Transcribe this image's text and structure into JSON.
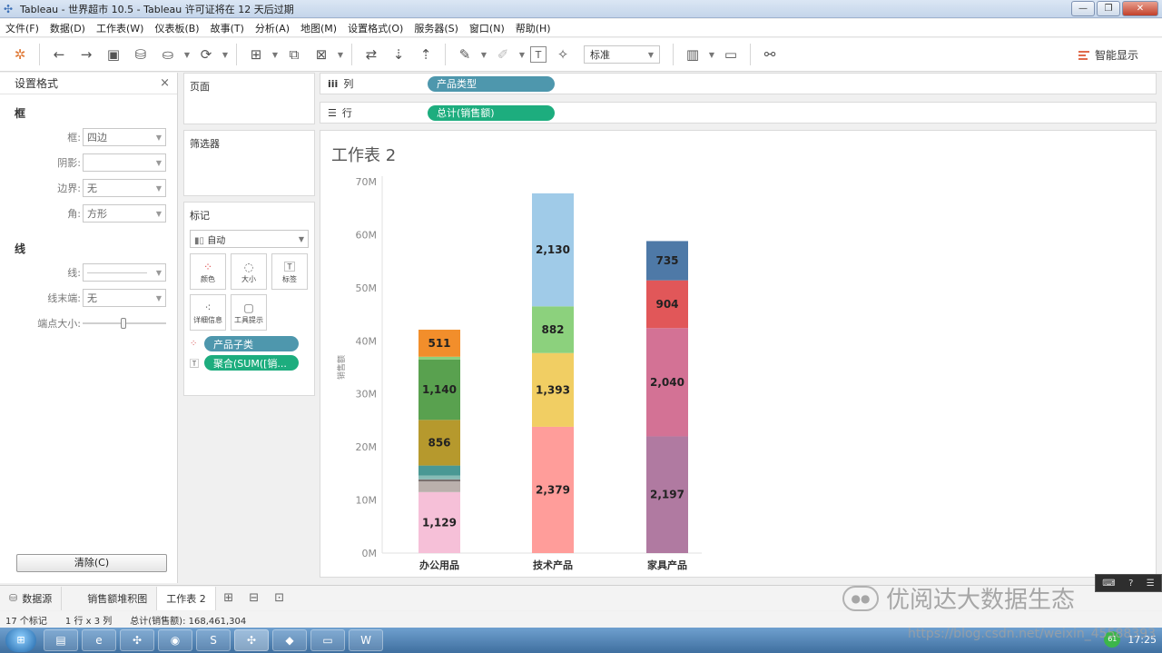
{
  "window": {
    "title": "Tableau - 世界超市 10.5 - Tableau 许可证将在 12 天后过期",
    "buttons": {
      "minimize": "—",
      "maximize": "❐",
      "close": "✕"
    }
  },
  "menu": [
    "文件(F)",
    "数据(D)",
    "工作表(W)",
    "仪表板(B)",
    "故事(T)",
    "分析(A)",
    "地图(M)",
    "设置格式(O)",
    "服务器(S)",
    "窗口(N)",
    "帮助(H)"
  ],
  "toolbar": {
    "fit_select": "标准",
    "smart_show": "智能显示"
  },
  "format_pane": {
    "title": "设置格式",
    "close": "×",
    "frame_section": "框",
    "frame_rows": [
      {
        "label": "框:",
        "value": "四边"
      },
      {
        "label": "阴影:",
        "value": ""
      },
      {
        "label": "边界:",
        "value": "无"
      },
      {
        "label": "角:",
        "value": "方形"
      }
    ],
    "line_section": "线",
    "line_rows": [
      {
        "label": "线:",
        "value": ""
      },
      {
        "label": "线末端:",
        "value": "无"
      }
    ],
    "endpoint_label": "端点大小:",
    "clear_button": "清除(C)"
  },
  "pages_card": {
    "title": "页面"
  },
  "filters_card": {
    "title": "筛选器"
  },
  "marks_card": {
    "title": "标记",
    "mark_type": "自动",
    "buttons": [
      {
        "label": "颜色",
        "icon": "color-dots-icon"
      },
      {
        "label": "大小",
        "icon": "size-icon"
      },
      {
        "label": "标签",
        "icon": "label-icon"
      },
      {
        "label": "详细信息",
        "icon": "detail-icon"
      },
      {
        "label": "工具提示",
        "icon": "tooltip-icon"
      }
    ],
    "pills": [
      {
        "label": "产品子类",
        "color": "#4e97ad"
      },
      {
        "label": "聚合(SUM([销...",
        "color": "#1dad7e"
      }
    ]
  },
  "shelves": {
    "columns_label": "列",
    "columns_pill": "产品类型",
    "rows_label": "行",
    "rows_pill": "总计(销售额)"
  },
  "sheet": {
    "title": "工作表 2"
  },
  "chart_data": {
    "type": "bar",
    "stacked": true,
    "categories": [
      "办公用品",
      "技术产品",
      "家具产品"
    ],
    "ylabel": "销售额",
    "ylim": [
      0,
      70000000
    ],
    "yticks": [
      "0M",
      "10M",
      "20M",
      "30M",
      "40M",
      "50M",
      "60M",
      "70M"
    ],
    "grid": false,
    "stacks": [
      {
        "category": "办公用品",
        "segments": [
          {
            "value": 11500000,
            "label": "1,129",
            "color": "#f6c0d8"
          },
          {
            "value": 2000000,
            "label": "",
            "color": "#bab0ac"
          },
          {
            "value": 400000,
            "label": "",
            "color": "#79706e"
          },
          {
            "value": 700000,
            "label": "",
            "color": "#86bcb6"
          },
          {
            "value": 1900000,
            "label": "",
            "color": "#499894"
          },
          {
            "value": 8600000,
            "label": "856",
            "color": "#b6992d"
          },
          {
            "value": 11400000,
            "label": "1,140",
            "color": "#59a14f"
          },
          {
            "value": 500000,
            "label": "",
            "color": "#8cd17d"
          },
          {
            "value": 5100000,
            "label": "511",
            "color": "#f28e2b"
          }
        ]
      },
      {
        "category": "技术产品",
        "segments": [
          {
            "value": 23800000,
            "label": "2,379",
            "color": "#ff9d9a"
          },
          {
            "value": 13900000,
            "label": "1,393",
            "color": "#f1ce63"
          },
          {
            "value": 8800000,
            "label": "882",
            "color": "#8cd17d"
          },
          {
            "value": 21300000,
            "label": "2,130",
            "color": "#a0cbe8"
          }
        ]
      },
      {
        "category": "家具产品",
        "segments": [
          {
            "value": 22000000,
            "label": "2,197",
            "color": "#b07aa1"
          },
          {
            "value": 20400000,
            "label": "2,040",
            "color": "#d37295"
          },
          {
            "value": 9000000,
            "label": "904",
            "color": "#e15759"
          },
          {
            "value": 7400000,
            "label": "735",
            "color": "#4e79a7"
          }
        ]
      }
    ]
  },
  "tabs": {
    "datasource": "数据源",
    "sheets": [
      "销售额堆积图",
      "工作表 2"
    ],
    "active": "工作表 2"
  },
  "status": {
    "marks": "17 个标记",
    "dims": "1 行 x 3 列",
    "total": "总计(销售额): 168,461,304"
  },
  "taskbar": {
    "tray_badge": "61",
    "time": "17:25"
  },
  "watermarks": {
    "wechat": "优阅达大数据生态",
    "url": "https://blog.csdn.net/weixin_45588393"
  }
}
